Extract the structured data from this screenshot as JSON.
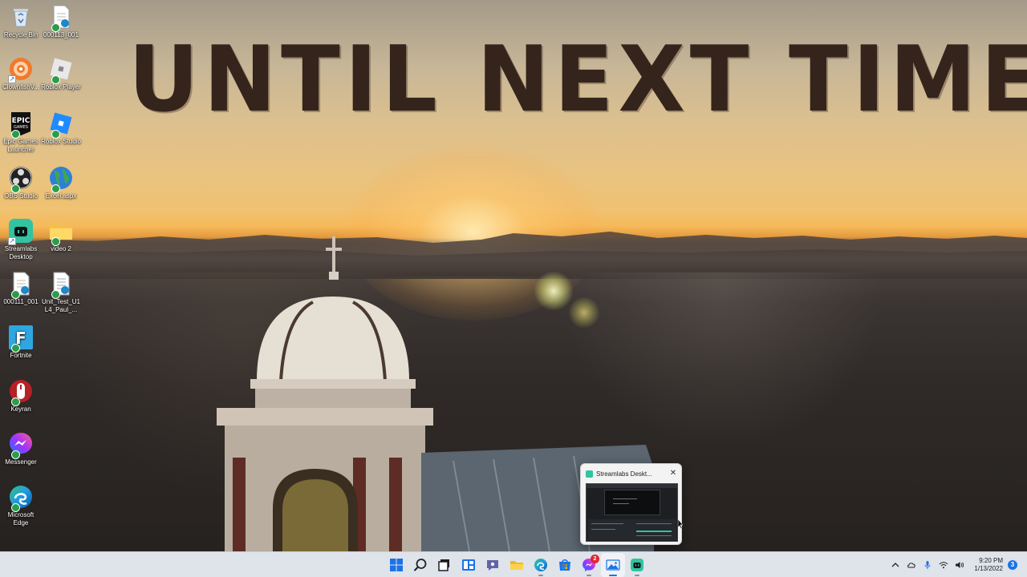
{
  "wallpaper": {
    "headline": "UNTIL NEXT TIME"
  },
  "desktop_icons": [
    {
      "label": "Recycle Bin",
      "icon": "recycle-bin-icon"
    },
    {
      "label": "000113_001",
      "icon": "document-icon"
    },
    {
      "label": "ClownfishV...",
      "icon": "clownfish-icon"
    },
    {
      "label": "Roblox Player",
      "icon": "roblox-player-icon"
    },
    {
      "label": "Epic Games Launcher",
      "icon": "epic-games-icon"
    },
    {
      "label": "Roblox Studio",
      "icon": "roblox-studio-icon"
    },
    {
      "label": "OBS Studio",
      "icon": "obs-studio-icon"
    },
    {
      "label": "Excel.aspx",
      "icon": "globe-icon"
    },
    {
      "label": "Streamlabs Desktop",
      "icon": "streamlabs-icon"
    },
    {
      "label": "video 2",
      "icon": "folder-icon"
    },
    {
      "label": "000111_001",
      "icon": "document-icon"
    },
    {
      "label": "Unit_Test_U1L4_Paul_...",
      "icon": "word-document-icon"
    },
    {
      "label": "Fortnite",
      "icon": "fortnite-icon"
    },
    {
      "label": "Keyran",
      "icon": "keyran-mouse-icon"
    },
    {
      "label": "Messenger",
      "icon": "messenger-icon"
    },
    {
      "label": "Microsoft Edge",
      "icon": "edge-icon"
    }
  ],
  "thumbnail": {
    "title": "Streamlabs Deskt...",
    "close_glyph": "✕"
  },
  "taskbar": {
    "apps": [
      {
        "name": "start",
        "icon": "windows-start-icon"
      },
      {
        "name": "search",
        "icon": "search-icon"
      },
      {
        "name": "task-view",
        "icon": "task-view-icon"
      },
      {
        "name": "widgets",
        "icon": "widgets-icon"
      },
      {
        "name": "chat",
        "icon": "teams-chat-icon"
      },
      {
        "name": "file-explorer",
        "icon": "folder-icon"
      },
      {
        "name": "edge",
        "icon": "edge-icon"
      },
      {
        "name": "store",
        "icon": "store-icon"
      },
      {
        "name": "messenger",
        "icon": "messenger-icon",
        "badge": "2"
      },
      {
        "name": "photos",
        "icon": "photos-icon"
      },
      {
        "name": "streamlabs",
        "icon": "streamlabs-icon"
      }
    ],
    "messenger_badge": "2",
    "clock_time": "9:20 PM",
    "clock_date": "1/13/2022",
    "notification_count": "3"
  },
  "colors": {
    "headline": "#34241c",
    "taskbar_bg": "#dfe3ea",
    "accent": "#1a73e8",
    "streamlabs": "#31c3a2"
  }
}
